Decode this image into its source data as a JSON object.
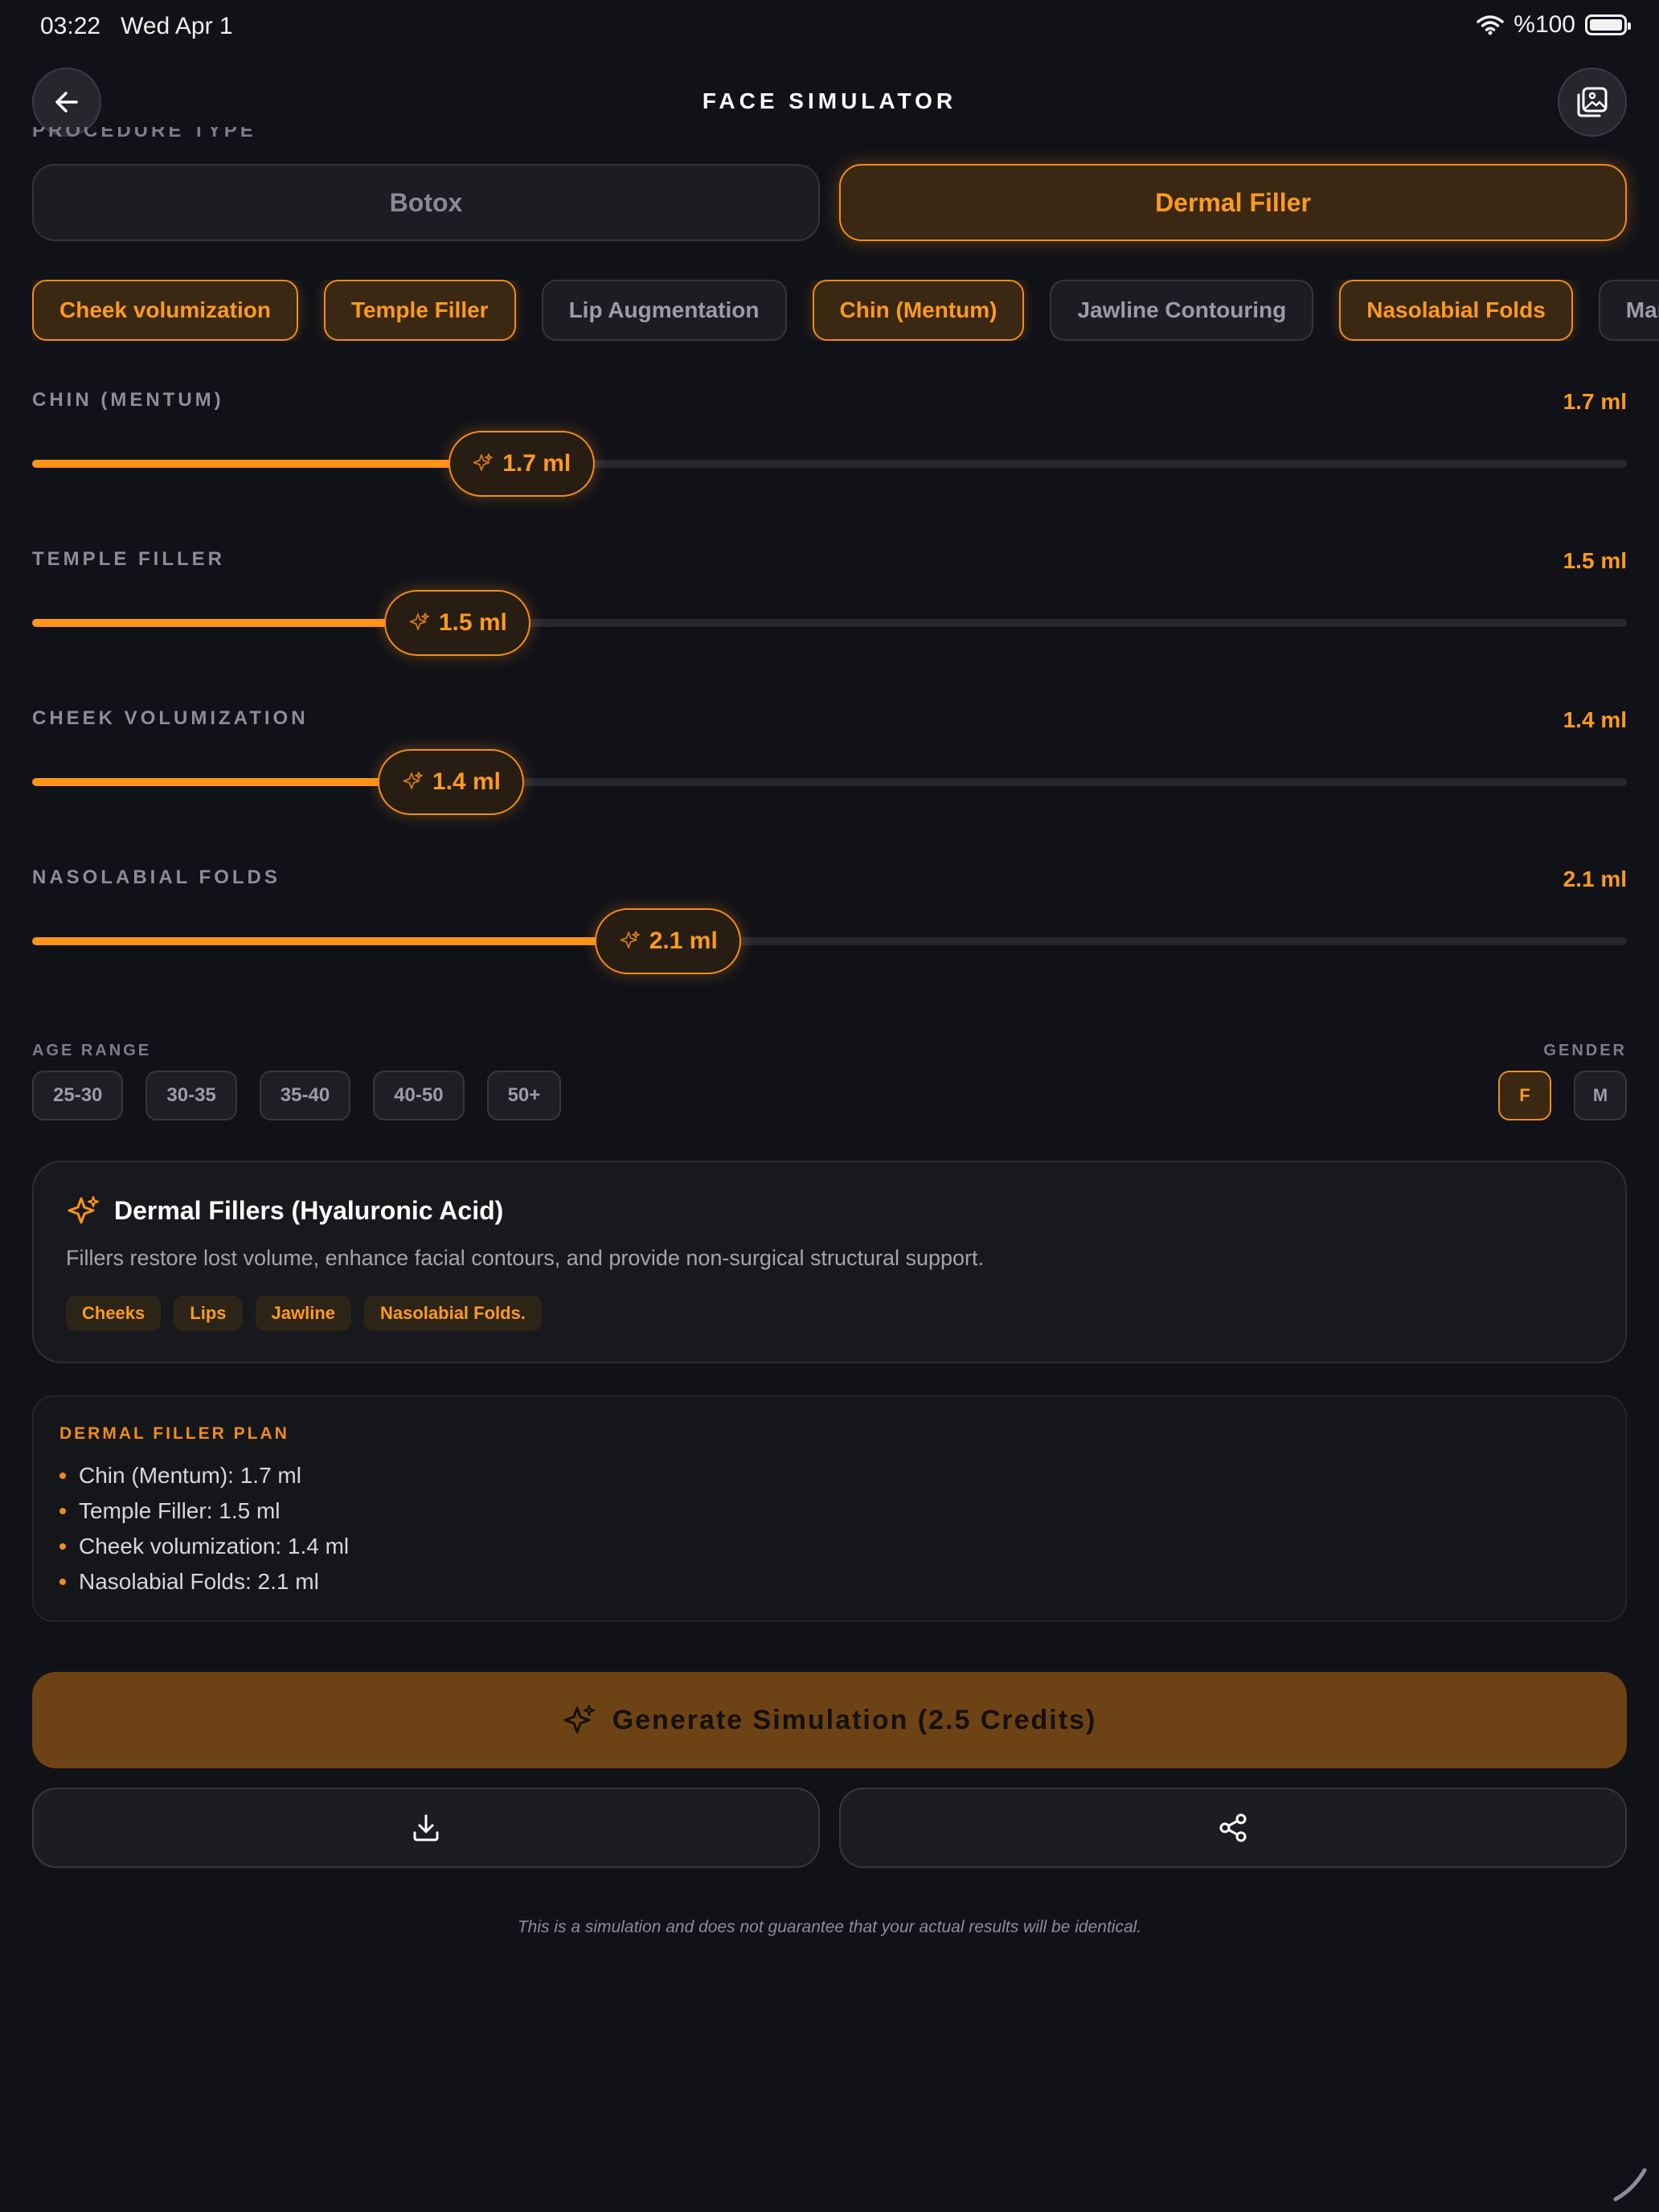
{
  "status_bar": {
    "time": "03:22",
    "date": "Wed Apr 1",
    "battery": "%100",
    "icons": [
      "wifi-icon",
      "battery-icon"
    ]
  },
  "header": {
    "title": "FACE SIMULATOR",
    "cut_section_label": "PROCEDURE TYPE",
    "back_icon": "arrow-left-icon",
    "gallery_icon": "image-gallery-icon"
  },
  "procedure_type": {
    "options": [
      {
        "label": "Botox",
        "selected": false
      },
      {
        "label": "Dermal Filler",
        "selected": true
      }
    ]
  },
  "areas": [
    {
      "label": "Cheek volumization",
      "selected": true
    },
    {
      "label": "Temple Filler",
      "selected": true
    },
    {
      "label": "Lip Augmentation",
      "selected": false
    },
    {
      "label": "Chin (Mentum)",
      "selected": true
    },
    {
      "label": "Jawline Contouring",
      "selected": false
    },
    {
      "label": "Nasolabial Folds",
      "selected": true
    },
    {
      "label": "Mario",
      "selected": false
    }
  ],
  "sliders": [
    {
      "label": "CHIN (MENTUM)",
      "value_text": "1.7 ml",
      "fraction": 0.266
    },
    {
      "label": "TEMPLE FILLER",
      "value_text": "1.5 ml",
      "fraction": 0.226
    },
    {
      "label": "CHEEK VOLUMIZATION",
      "value_text": "1.4 ml",
      "fraction": 0.222
    },
    {
      "label": "NASOLABIAL FOLDS",
      "value_text": "2.1 ml",
      "fraction": 0.358
    }
  ],
  "age_range": {
    "label": "AGE RANGE",
    "options": [
      "25-30",
      "30-35",
      "35-40",
      "40-50",
      "50+"
    ]
  },
  "gender": {
    "label": "GENDER",
    "options": [
      {
        "label": "F",
        "selected": true
      },
      {
        "label": "M",
        "selected": false
      }
    ]
  },
  "info": {
    "icon": "sparkle-icon",
    "title": "Dermal Fillers (Hyaluronic Acid)",
    "description": "Fillers restore lost volume, enhance facial contours, and provide non-surgical structural support.",
    "tags": [
      "Cheeks",
      "Lips",
      "Jawline",
      "Nasolabial Folds."
    ]
  },
  "plan": {
    "title": "DERMAL FILLER PLAN",
    "items": [
      "Chin (Mentum): 1.7 ml",
      "Temple Filler: 1.5 ml",
      "Cheek volumization: 1.4 ml",
      "Nasolabial Folds: 2.1 ml"
    ]
  },
  "actions": {
    "generate_label": "Generate Simulation (2.5 Credits)",
    "download_icon": "download-icon",
    "share_icon": "share-icon"
  },
  "disclaimer": "This is a simulation and does not guarantee that your actual results will be identical.",
  "colors": {
    "background": "#111218",
    "accent": "#ff9418",
    "accent_dark": "#6d4315"
  }
}
